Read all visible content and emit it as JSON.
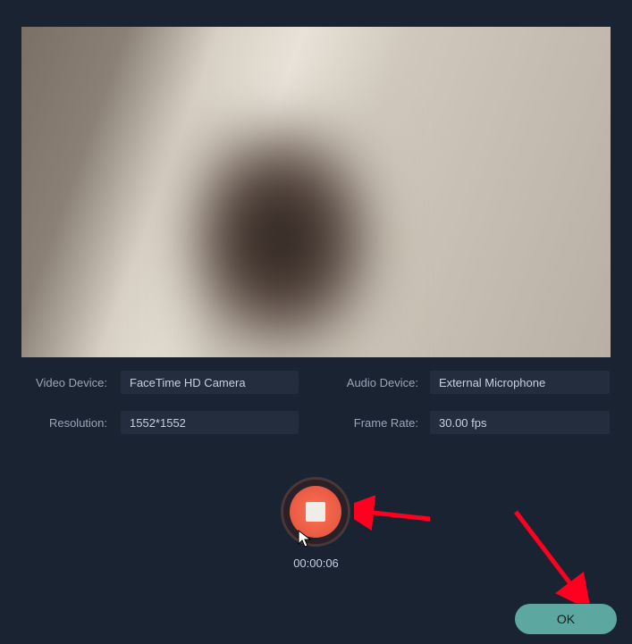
{
  "labels": {
    "video_device": "Video Device:",
    "audio_device": "Audio Device:",
    "resolution": "Resolution:",
    "frame_rate": "Frame Rate:"
  },
  "fields": {
    "video_device": "FaceTime HD Camera",
    "audio_device": "External Microphone",
    "resolution": "1552*1552",
    "frame_rate": "30.00 fps"
  },
  "timer": "00:00:06",
  "ok_button": "OK",
  "colors": {
    "accent_ok": "#5ca8a0",
    "record_red": "#e85a42",
    "arrow": "#ff0020"
  }
}
